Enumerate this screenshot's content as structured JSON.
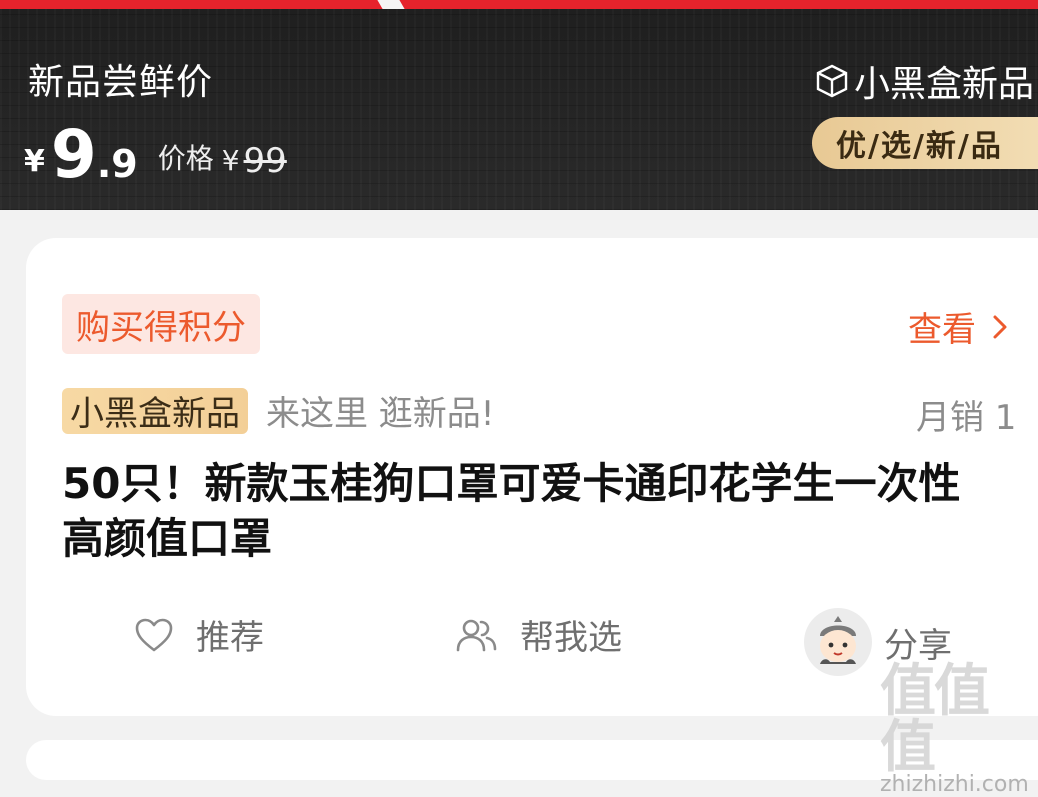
{
  "banner": {
    "title": "新品尝鲜价",
    "price_yen": "¥",
    "price_int": "9",
    "price_dec": ".9",
    "original_label": "价格",
    "original_yen": "¥",
    "original_value": "99",
    "logo_text": "小黑盒新品",
    "tag": "优/选/新/品"
  },
  "card": {
    "points_badge": "购买得积分",
    "view_link": "查看",
    "brand_badge": "小黑盒新品",
    "brand_slogan": "来这里 逛新品!",
    "monthly_sales": "月销 1",
    "product_title": "50只！新款玉桂狗口罩可爱卡通印花学生一次性高颜值口罩"
  },
  "actions": {
    "recommend": "推荐",
    "help_choose": "帮我选",
    "share": "分享"
  },
  "watermark": {
    "glyphs": "值值值",
    "url": "zhizhizhi.com"
  },
  "colors": {
    "accent": "#ec5a2d",
    "banner_bg": "#232323",
    "gold": "#e8c994"
  }
}
